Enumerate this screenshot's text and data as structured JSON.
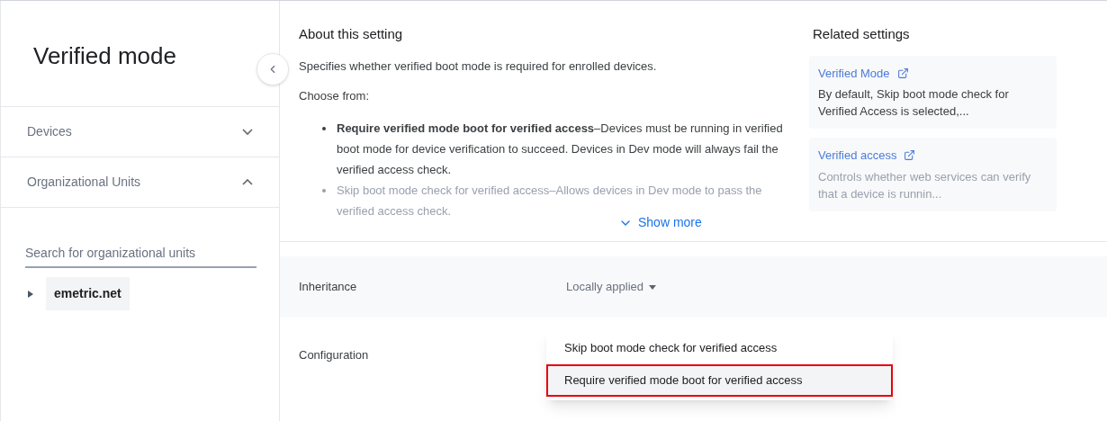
{
  "sidebar": {
    "title": "Verified mode",
    "sections": [
      {
        "label": "Devices",
        "expanded": false
      },
      {
        "label": "Organizational Units",
        "expanded": true
      }
    ],
    "search": {
      "placeholder": "Search for organizational units"
    },
    "tree": [
      {
        "label": "emetric.net",
        "selected": true,
        "expanded": false
      }
    ]
  },
  "about": {
    "title": "About this setting",
    "description": "Specifies whether verified boot mode is required for enrolled devices.",
    "intro": "Choose from:",
    "options": [
      {
        "text": "**Require verified mode boot for verified access**–Devices must be running in verified boot mode for device verification to succeed. Devices in Dev mode will always fail the verified access check.",
        "faded": false
      },
      {
        "text": "Skip boot mode check for verified access–Allows devices in Dev mode to pass the verified access check.",
        "faded": true
      }
    ],
    "show_more": "Show more"
  },
  "related": {
    "title": "Related settings",
    "items": [
      {
        "title": "Verified Mode",
        "description": "By default, Skip boot mode check for Verified Access is selected,...",
        "faded": false
      },
      {
        "title": "Verified access",
        "description": "Controls whether web services can verify that a device is runnin...",
        "faded": true
      }
    ]
  },
  "inheritance": {
    "label": "Inheritance",
    "value": "Locally applied"
  },
  "configuration": {
    "label": "Configuration",
    "menu": [
      {
        "label": "Skip boot mode check for verified access",
        "selected": false
      },
      {
        "label": "Require verified mode boot for verified access",
        "selected": true
      }
    ]
  }
}
